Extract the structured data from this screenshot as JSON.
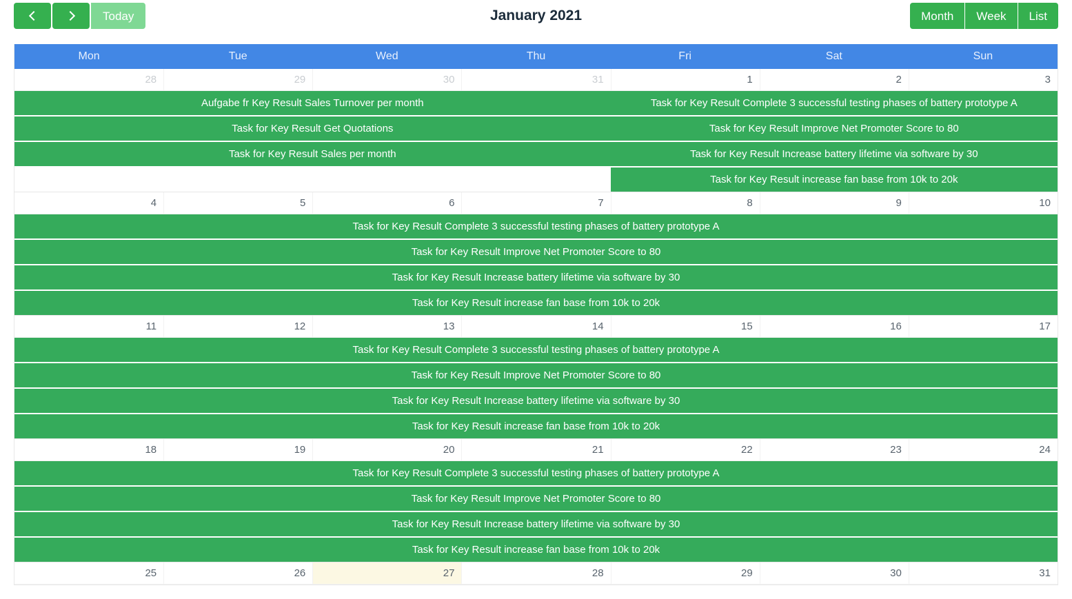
{
  "toolbar": {
    "prev_label": "",
    "next_label": "",
    "today_label": "Today",
    "title": "January 2021",
    "views": [
      {
        "label": "Month"
      },
      {
        "label": "Week"
      },
      {
        "label": "List"
      }
    ]
  },
  "calendar": {
    "day_headers": [
      "Mon",
      "Tue",
      "Wed",
      "Thu",
      "Fri",
      "Sat",
      "Sun"
    ],
    "accent_blue": "#4287e5",
    "event_green": "#35ab5b",
    "button_green": "#35b04f",
    "today_highlight": "#fcf8e3",
    "weeks": [
      {
        "dates": [
          {
            "num": "28",
            "other_month": true,
            "today": false
          },
          {
            "num": "29",
            "other_month": true,
            "today": false
          },
          {
            "num": "30",
            "other_month": true,
            "today": false
          },
          {
            "num": "31",
            "other_month": true,
            "today": false
          },
          {
            "num": "1",
            "other_month": false,
            "today": false
          },
          {
            "num": "2",
            "other_month": false,
            "today": false
          },
          {
            "num": "3",
            "other_month": false,
            "today": false
          }
        ],
        "event_rows": [
          [
            {
              "title": "Aufgabe fr Key Result Sales Turnover per month",
              "start": 1,
              "span": 4
            },
            {
              "title": "Task for Key Result Complete 3 successful testing phases of battery prototype A",
              "start": 5,
              "span": 3
            }
          ],
          [
            {
              "title": "Task for Key Result Get Quotations",
              "start": 1,
              "span": 4
            },
            {
              "title": "Task for Key Result Improve Net Promoter Score to 80",
              "start": 5,
              "span": 3
            }
          ],
          [
            {
              "title": "Task for Key Result Sales per month",
              "start": 1,
              "span": 4
            },
            {
              "title": "Task for Key Result Increase battery lifetime via software by 30",
              "start": 5,
              "span": 3
            }
          ],
          [
            {
              "title": "Task for Key Result increase fan base from 10k to 20k",
              "start": 5,
              "span": 3
            }
          ]
        ]
      },
      {
        "dates": [
          {
            "num": "4",
            "other_month": false,
            "today": false
          },
          {
            "num": "5",
            "other_month": false,
            "today": false
          },
          {
            "num": "6",
            "other_month": false,
            "today": false
          },
          {
            "num": "7",
            "other_month": false,
            "today": false
          },
          {
            "num": "8",
            "other_month": false,
            "today": false
          },
          {
            "num": "9",
            "other_month": false,
            "today": false
          },
          {
            "num": "10",
            "other_month": false,
            "today": false
          }
        ],
        "event_rows": [
          [
            {
              "title": "Task for Key Result Complete 3 successful testing phases of battery prototype A",
              "start": 1,
              "span": 7
            }
          ],
          [
            {
              "title": "Task for Key Result Improve Net Promoter Score to 80",
              "start": 1,
              "span": 7
            }
          ],
          [
            {
              "title": "Task for Key Result Increase battery lifetime via software by 30",
              "start": 1,
              "span": 7
            }
          ],
          [
            {
              "title": "Task for Key Result increase fan base from 10k to 20k",
              "start": 1,
              "span": 7
            }
          ]
        ]
      },
      {
        "dates": [
          {
            "num": "11",
            "other_month": false,
            "today": false
          },
          {
            "num": "12",
            "other_month": false,
            "today": false
          },
          {
            "num": "13",
            "other_month": false,
            "today": false
          },
          {
            "num": "14",
            "other_month": false,
            "today": false
          },
          {
            "num": "15",
            "other_month": false,
            "today": false
          },
          {
            "num": "16",
            "other_month": false,
            "today": false
          },
          {
            "num": "17",
            "other_month": false,
            "today": false
          }
        ],
        "event_rows": [
          [
            {
              "title": "Task for Key Result Complete 3 successful testing phases of battery prototype A",
              "start": 1,
              "span": 7
            }
          ],
          [
            {
              "title": "Task for Key Result Improve Net Promoter Score to 80",
              "start": 1,
              "span": 7
            }
          ],
          [
            {
              "title": "Task for Key Result Increase battery lifetime via software by 30",
              "start": 1,
              "span": 7
            }
          ],
          [
            {
              "title": "Task for Key Result increase fan base from 10k to 20k",
              "start": 1,
              "span": 7
            }
          ]
        ]
      },
      {
        "dates": [
          {
            "num": "18",
            "other_month": false,
            "today": false
          },
          {
            "num": "19",
            "other_month": false,
            "today": false
          },
          {
            "num": "20",
            "other_month": false,
            "today": false
          },
          {
            "num": "21",
            "other_month": false,
            "today": false
          },
          {
            "num": "22",
            "other_month": false,
            "today": false
          },
          {
            "num": "23",
            "other_month": false,
            "today": false
          },
          {
            "num": "24",
            "other_month": false,
            "today": false
          }
        ],
        "event_rows": [
          [
            {
              "title": "Task for Key Result Complete 3 successful testing phases of battery prototype A",
              "start": 1,
              "span": 7
            }
          ],
          [
            {
              "title": "Task for Key Result Improve Net Promoter Score to 80",
              "start": 1,
              "span": 7
            }
          ],
          [
            {
              "title": "Task for Key Result Increase battery lifetime via software by 30",
              "start": 1,
              "span": 7
            }
          ],
          [
            {
              "title": "Task for Key Result increase fan base from 10k to 20k",
              "start": 1,
              "span": 7
            }
          ]
        ]
      },
      {
        "dates": [
          {
            "num": "25",
            "other_month": false,
            "today": false
          },
          {
            "num": "26",
            "other_month": false,
            "today": false
          },
          {
            "num": "27",
            "other_month": false,
            "today": true
          },
          {
            "num": "28",
            "other_month": false,
            "today": false
          },
          {
            "num": "29",
            "other_month": false,
            "today": false
          },
          {
            "num": "30",
            "other_month": false,
            "today": false
          },
          {
            "num": "31",
            "other_month": false,
            "today": false
          }
        ],
        "event_rows": []
      }
    ]
  }
}
